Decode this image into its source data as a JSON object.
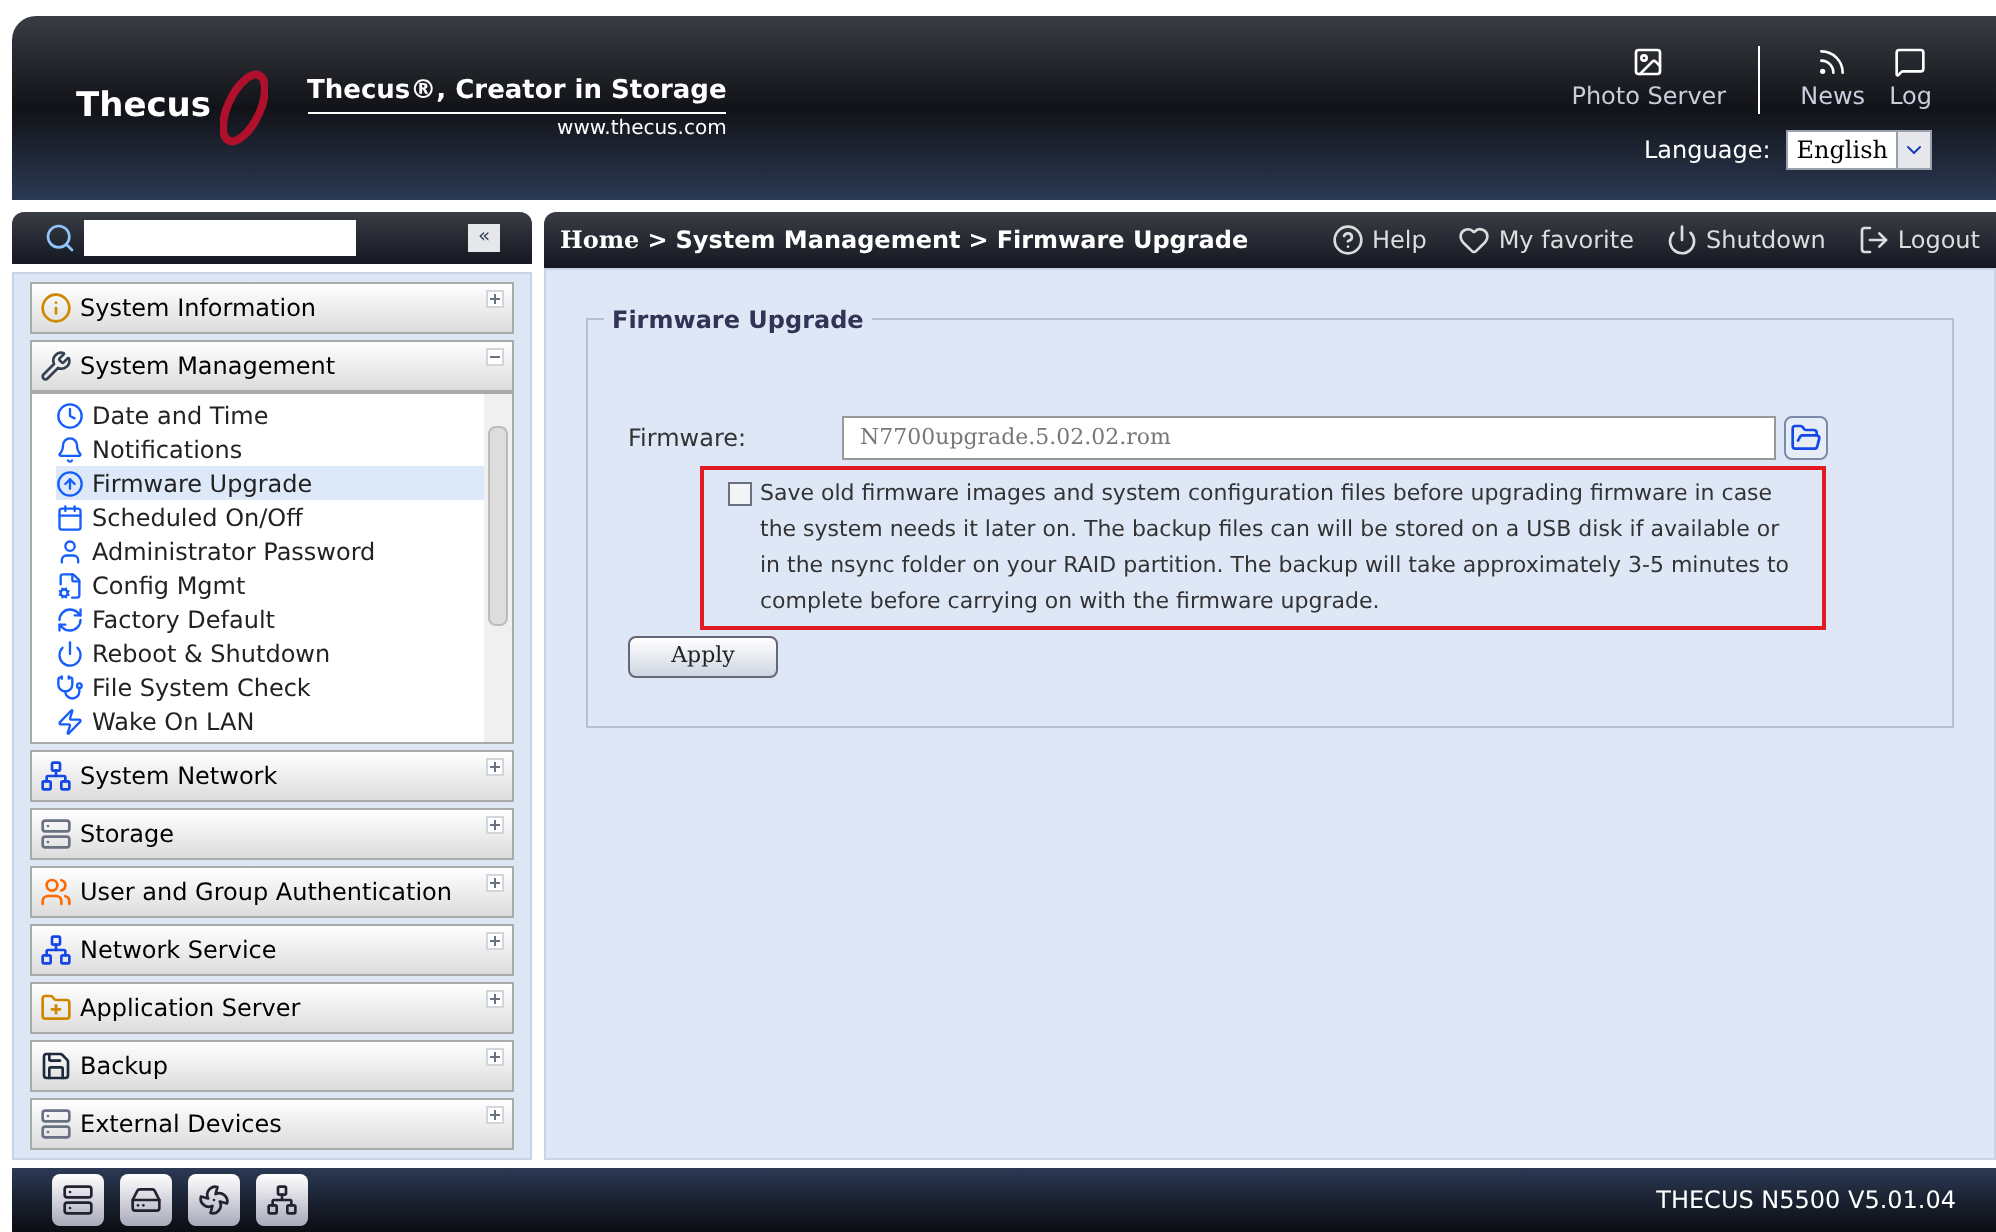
{
  "header": {
    "logo": "Thecus",
    "tagline": "Thecus®, Creator in Storage",
    "website": "www.thecus.com",
    "shortcuts": [
      {
        "kind": "photo",
        "label": "Photo Server"
      },
      {
        "kind": "news",
        "label": "News"
      },
      {
        "kind": "log",
        "label": "Log"
      }
    ],
    "language_label": "Language:",
    "language_value": "English"
  },
  "sidebar": {
    "collapse": "«",
    "categories": [
      {
        "kind": "info",
        "label": "System Information",
        "expanded": false
      },
      {
        "kind": "tools",
        "label": "System Management",
        "expanded": true,
        "children": [
          {
            "kind": "clock",
            "label": "Date and Time",
            "selected": false
          },
          {
            "kind": "bell",
            "label": "Notifications",
            "selected": false
          },
          {
            "kind": "upgrade",
            "label": "Firmware Upgrade",
            "selected": true
          },
          {
            "kind": "calendar",
            "label": "Scheduled On/Off",
            "selected": false
          },
          {
            "kind": "user",
            "label": "Administrator Password",
            "selected": false
          },
          {
            "kind": "config",
            "label": "Config Mgmt",
            "selected": false
          },
          {
            "kind": "reset",
            "label": "Factory Default",
            "selected": false
          },
          {
            "kind": "power",
            "label": "Reboot & Shutdown",
            "selected": false
          },
          {
            "kind": "check",
            "label": "File System Check",
            "selected": false
          },
          {
            "kind": "wake",
            "label": "Wake On LAN",
            "selected": false
          }
        ]
      },
      {
        "kind": "network",
        "label": "System Network",
        "expanded": false
      },
      {
        "kind": "storage",
        "label": "Storage",
        "expanded": false
      },
      {
        "kind": "users",
        "label": "User and Group Authentication",
        "expanded": false
      },
      {
        "kind": "network",
        "label": "Network Service",
        "expanded": false
      },
      {
        "kind": "folder",
        "label": "Application Server",
        "expanded": false
      },
      {
        "kind": "backup",
        "label": "Backup",
        "expanded": false
      },
      {
        "kind": "storage",
        "label": "External Devices",
        "expanded": false
      }
    ]
  },
  "toolbar": {
    "breadcrumb": [
      "Home",
      "System Management",
      "Firmware Upgrade"
    ],
    "separator": ">",
    "actions": [
      {
        "kind": "help",
        "label": "Help"
      },
      {
        "kind": "favorite",
        "label": "My favorite"
      },
      {
        "kind": "shutdown",
        "label": "Shutdown"
      },
      {
        "kind": "logout",
        "label": "Logout"
      }
    ]
  },
  "panel": {
    "title": "Firmware Upgrade",
    "firmware_label": "Firmware:",
    "firmware_value": "N7700upgrade.5.02.02.rom",
    "backup_checked": false,
    "backup_text": "Save old firmware images and system configuration files before upgrading firmware in case the system needs it later on. The backup files can will be stored on a USB disk if available or in the nsync folder on your RAID partition. The backup will take approximately 3-5 minutes to complete before carrying on with the firmware upgrade.",
    "apply": "Apply"
  },
  "footer": {
    "status_icons": [
      {
        "kind": "server"
      },
      {
        "kind": "disk"
      },
      {
        "kind": "fan"
      },
      {
        "kind": "network"
      }
    ],
    "version": "THECUS N5500 V5.01.04"
  }
}
